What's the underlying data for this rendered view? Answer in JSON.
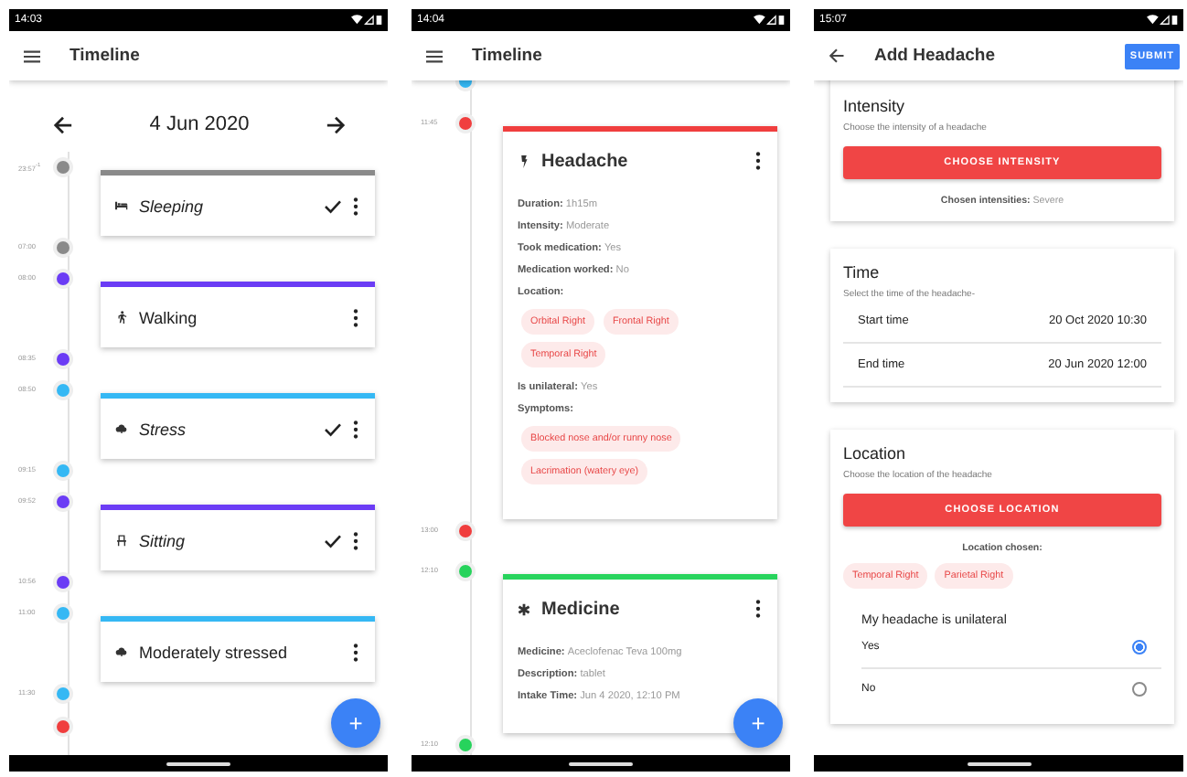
{
  "screens": [
    {
      "kind": "timeline",
      "status_time": "14:03",
      "title": "Timeline",
      "date": "4 Jun 2020",
      "events": [
        {
          "kind": "sleeping",
          "label": "Sleeping",
          "color": "#8a8a8a",
          "start": "23:57$^{-1}$",
          "end": "07:00",
          "unconfirmed": true
        },
        {
          "kind": "walking",
          "label": "Walking",
          "color": "#6b3cf5",
          "start": "08:00",
          "end": "08:35",
          "unconfirmed": false
        },
        {
          "kind": "stress",
          "label": "Stress",
          "color": "#35b8f4",
          "start": "08:50",
          "end": "09:15",
          "unconfirmed": true
        },
        {
          "kind": "sitting",
          "label": "Sitting",
          "color": "#6b3cf5",
          "start": "09:52",
          "end": "10:56",
          "unconfirmed": true
        },
        {
          "kind": "stress",
          "label": "Moderately stressed",
          "color": "#35b8f4",
          "start": "11:00",
          "end": "11:30",
          "unconfirmed": false
        }
      ],
      "trailing_marker": {
        "color": "#f03e3e"
      },
      "fab": "+"
    },
    {
      "kind": "timeline",
      "status_time": "14:04",
      "title": "Timeline",
      "leading_marker": {
        "color": "#35b8f4"
      },
      "events": [
        {
          "kind": "headache",
          "label": "Headache",
          "color": "#f03e3e",
          "start": "11:45",
          "end": "13:00",
          "unconfirmed": false,
          "details": [
            {
              "kind": "field",
              "label": "Duration:",
              "value": "1h15m"
            },
            {
              "kind": "field",
              "label": "Intensity:",
              "value": "Moderate"
            },
            {
              "kind": "field",
              "label": "Took medication:",
              "value": "Yes"
            },
            {
              "kind": "field",
              "label": "Medication worked:",
              "value": "No"
            },
            {
              "kind": "field",
              "label": "Location:"
            },
            {
              "kind": "chips",
              "items": [
                "Orbital Right",
                "Frontal Right",
                "Temporal Right"
              ]
            },
            {
              "kind": "field",
              "label": "Is unilateral:",
              "value": "Yes"
            },
            {
              "kind": "field",
              "label": "Symptoms:"
            },
            {
              "kind": "chips",
              "items": [
                "Blocked nose and/or runny nose",
                "Lacrimation (watery eye)"
              ]
            }
          ]
        },
        {
          "kind": "medicine",
          "label": "Medicine",
          "color": "#27d35c",
          "start": "12:10",
          "end": "12:10",
          "unconfirmed": false,
          "details": [
            {
              "kind": "field",
              "label": "Medicine:",
              "value": "Aceclofenac Teva 100mg"
            },
            {
              "kind": "field",
              "label": "Description:",
              "value": "tablet"
            },
            {
              "kind": "field",
              "label": "Intake Time:",
              "value": "Jun 4 2020, 12:10 PM"
            }
          ]
        }
      ],
      "fab": "+"
    },
    {
      "kind": "form",
      "status_time": "15:07",
      "title": "Add Headache",
      "submit": "SUBMIT",
      "sections": [
        {
          "kind": "intensity",
          "title": "Intensity",
          "subtitle": "Choose the intensity of a headache",
          "button": "CHOOSE INTENSITY",
          "result_label": "Chosen intensities:",
          "result_value": "Severe"
        },
        {
          "kind": "time",
          "title": "Time",
          "subtitle": "Select the time of the headache-",
          "rows": [
            {
              "label": "Start time",
              "value": "20 Oct 2020 10:30"
            },
            {
              "label": "End time",
              "value": "20 Jun 2020 12:00"
            }
          ]
        },
        {
          "kind": "location",
          "title": "Location",
          "subtitle": "Choose the location of the headache",
          "button": "CHOOSE LOCATION",
          "result_label": "Location chosen:",
          "chips": [
            "Temporal Right",
            "Parietal Right"
          ],
          "question": "My headache is unilateral",
          "options": [
            {
              "label": "Yes",
              "selected": true
            },
            {
              "label": "No",
              "selected": false
            }
          ]
        }
      ]
    }
  ]
}
